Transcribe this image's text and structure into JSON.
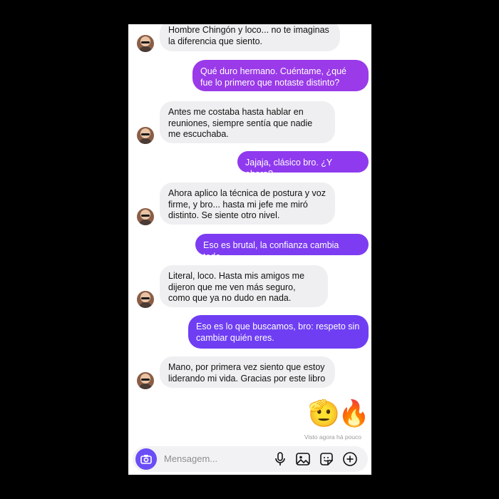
{
  "messages": [
    {
      "from": "them",
      "text": "Hombre Chingón y loco... no te imaginas la diferencia que siento."
    },
    {
      "from": "me",
      "text": "Qué duro hermano. Cuéntame, ¿qué fue lo primero que notaste distinto?"
    },
    {
      "from": "them",
      "text": "Antes me costaba hasta hablar en reuniones, siempre sentía que nadie me escuchaba."
    },
    {
      "from": "me",
      "text": "Jajaja, clásico bro. ¿Y ahora?"
    },
    {
      "from": "them",
      "text": "Ahora aplico la técnica de postura y voz firme, y bro... hasta mi jefe me miró distinto. Se siente otro nivel."
    },
    {
      "from": "me",
      "text": "Eso es brutal, la confianza cambia todo."
    },
    {
      "from": "them",
      "text": "Literal, loco. Hasta mis amigos me dijeron que me ven más seguro, como que ya no dudo en nada."
    },
    {
      "from": "me",
      "text": "Eso es lo que buscamos, bro: respeto sin cambiar quién eres."
    },
    {
      "from": "them",
      "text": "Mano, por primera vez siento que estoy liderando mi vida. Gracias por este libro"
    }
  ],
  "reactions": {
    "salute": "🫡",
    "fire": "🔥"
  },
  "seen_status": "Visto agora há pouco",
  "composer": {
    "placeholder": "Mensagem..."
  },
  "icons": [
    "camera-icon",
    "microphone-icon",
    "gallery-icon",
    "sticker-icon",
    "plus-icon"
  ],
  "colors": {
    "outgoing_top": "#9b34e8",
    "outgoing_bottom": "#6d3df3",
    "incoming": "#efeff1",
    "accent": "#6b4ef6"
  }
}
